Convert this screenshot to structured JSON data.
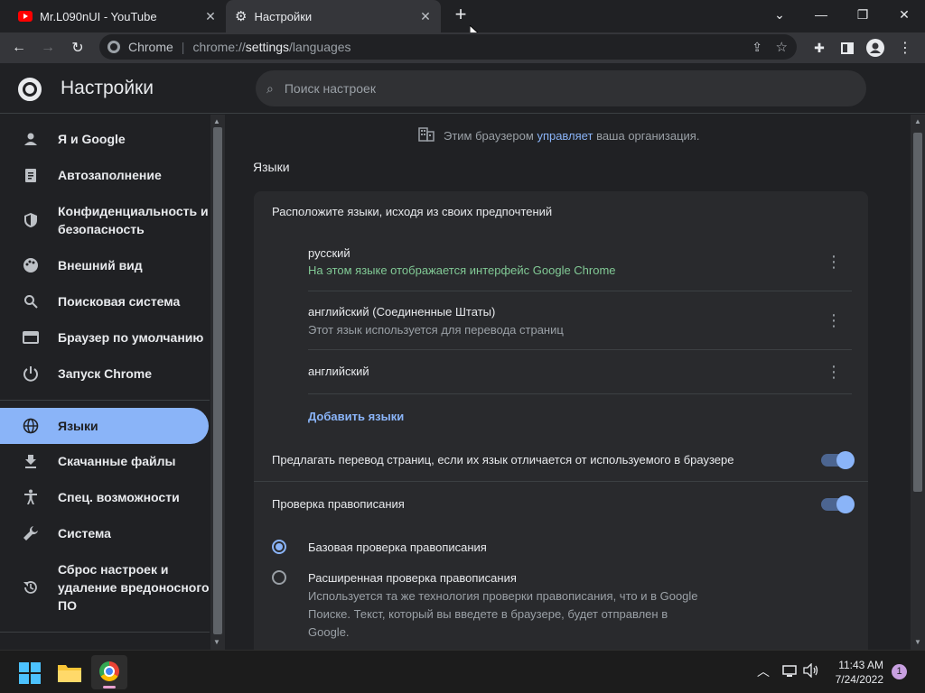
{
  "tabs": [
    {
      "title": "Mr.L090nUI - YouTube",
      "icon": "youtube-icon"
    },
    {
      "title": "Настройки",
      "icon": "gear-icon"
    }
  ],
  "omnibox": {
    "site_label": "Chrome",
    "url_prefix": "chrome://",
    "url_host": "settings",
    "url_path": "/languages"
  },
  "header": {
    "title": "Настройки",
    "search_placeholder": "Поиск настроек"
  },
  "sidebar": {
    "items": [
      {
        "label": "Я и Google",
        "icon": "person-icon"
      },
      {
        "label": "Автозаполнение",
        "icon": "clipboard-icon"
      },
      {
        "label": "Конфиденциальность и безопасность",
        "line1": "Конфиденциальность и",
        "line2": "безопасность",
        "icon": "shield-icon"
      },
      {
        "label": "Внешний вид",
        "icon": "palette-icon"
      },
      {
        "label": "Поисковая система",
        "icon": "search-icon"
      },
      {
        "label": "Браузер по умолчанию",
        "icon": "browser-icon"
      },
      {
        "label": "Запуск Chrome",
        "icon": "power-icon"
      },
      {
        "label": "Языки",
        "icon": "globe-icon",
        "active": true
      },
      {
        "label": "Скачанные файлы",
        "icon": "download-icon"
      },
      {
        "label": "Спец. возможности",
        "icon": "accessibility-icon"
      },
      {
        "label": "Система",
        "icon": "wrench-icon"
      },
      {
        "label": "Сброс настроек и удаление вредоносного ПО",
        "line1": "Сброс настроек и",
        "line2": "удаление вредоносного",
        "line3": "ПО",
        "icon": "restore-icon"
      }
    ]
  },
  "managed": {
    "prefix": "Этим браузером",
    "link": "управляет",
    "suffix": "ваша организация."
  },
  "languages": {
    "section_title": "Языки",
    "order_heading": "Расположите языки, исходя из своих предпочтений",
    "list": [
      {
        "name": "русский",
        "note": "На этом языке отображается интерфейс Google Chrome"
      },
      {
        "name": "английский (Соединенные Штаты)",
        "note": "Этот язык используется для перевода страниц"
      },
      {
        "name": "английский",
        "note": ""
      }
    ],
    "add_link": "Добавить языки",
    "offer_translate": "Предлагать перевод страниц, если их язык отличается от используемого в браузере",
    "spellcheck": "Проверка правописания",
    "basic_spell": "Базовая проверка правописания",
    "enhanced_spell": "Расширенная проверка правописания",
    "enhanced_desc1": "Используется та же технология проверки правописания, что и в Google",
    "enhanced_desc2": "Поиске. Текст, который вы введете в браузере, будет отправлен в",
    "enhanced_desc3": "Google.",
    "offer_translate_on": true,
    "spellcheck_on": true,
    "selected_mode": "basic"
  },
  "taskbar": {
    "time": "11:43 AM",
    "date": "7/24/2022",
    "notification_count": "1"
  },
  "colors": {
    "accent": "#8ab4f8",
    "green_note": "#81c995",
    "bg": "#202124"
  }
}
